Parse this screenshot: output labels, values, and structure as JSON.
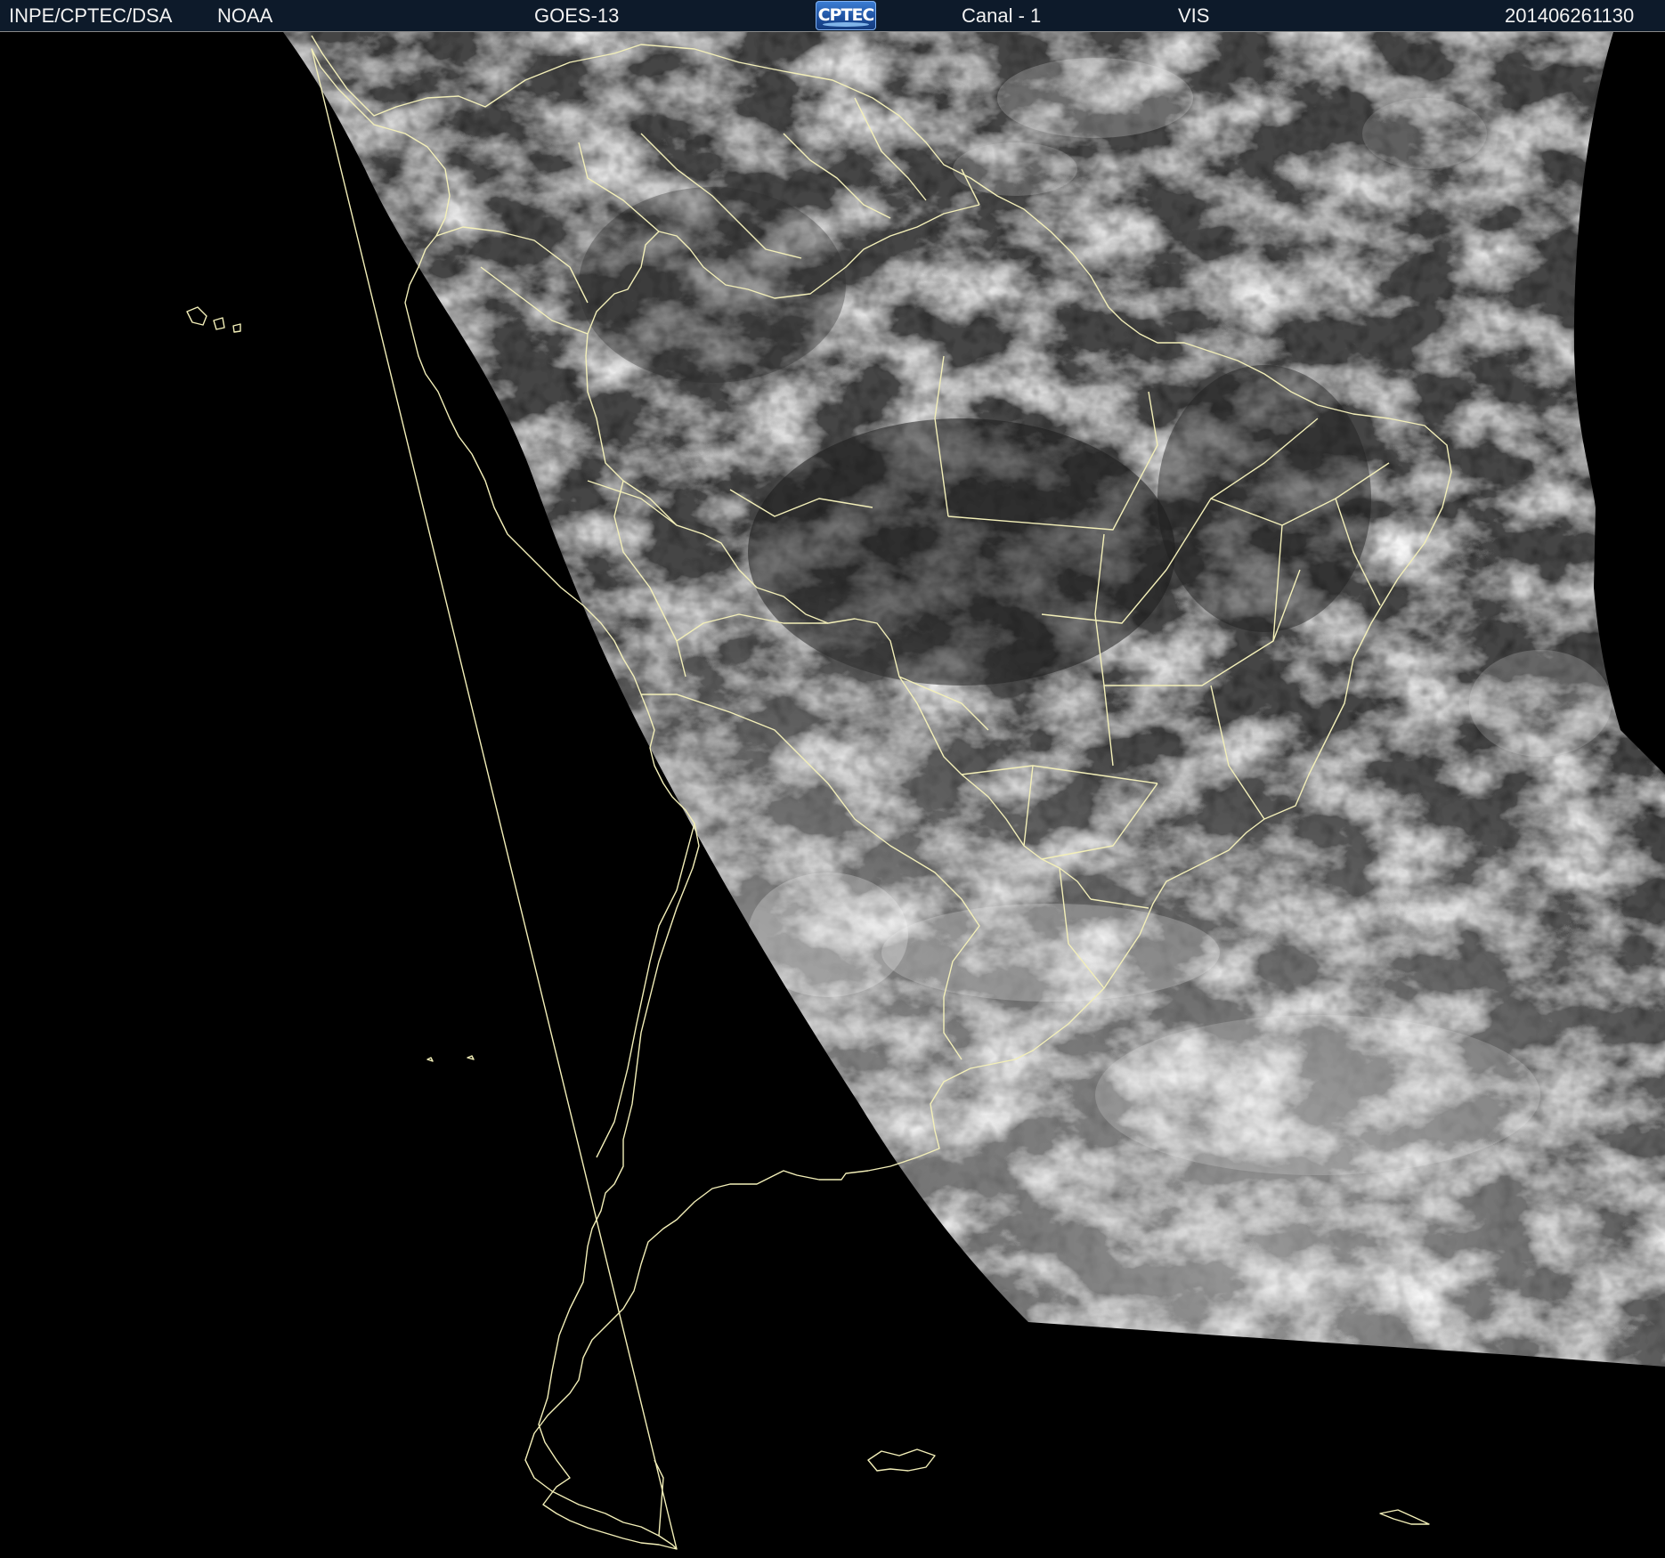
{
  "header": {
    "institution": "INPE/CPTEC/DSA",
    "agency": "NOAA",
    "satellite": "GOES-13",
    "logo_text": "CPTEC",
    "channel": "Canal - 1",
    "band": "VIS",
    "timestamp": "201406261130"
  },
  "colors": {
    "background": "#000000",
    "header_bar": "#0d1a2a",
    "header_text": "#f2f2f2",
    "coastline": "#f3efb8",
    "cloud_base": "#4a4a4a"
  },
  "map": {
    "type": "visible-channel satellite image",
    "region": "South America",
    "overlays": [
      "coastlines",
      "country borders",
      "brazilian state borders"
    ]
  }
}
